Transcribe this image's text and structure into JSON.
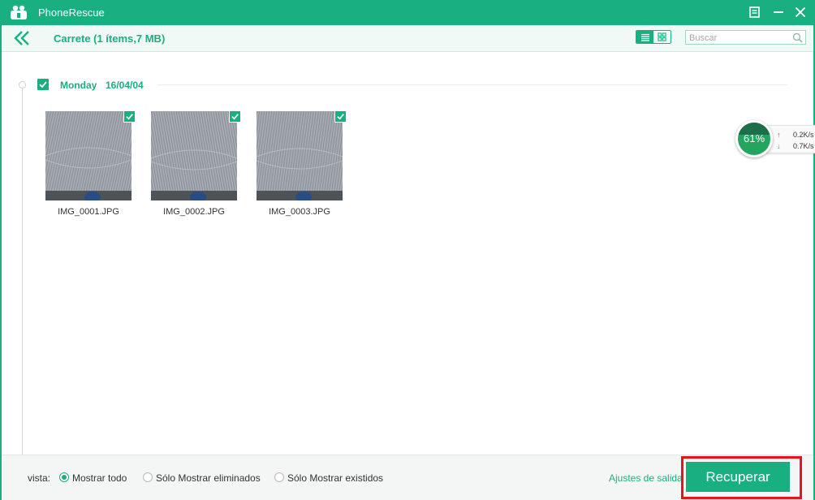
{
  "window": {
    "app_title": "PhoneRescue"
  },
  "toolbar": {
    "title": "Carrete (1 ítems,7 MB)",
    "search_placeholder": "Buscar"
  },
  "group": {
    "day": "Monday",
    "date": "16/04/04"
  },
  "photos": [
    {
      "name": "IMG_0001.JPG",
      "checked": true
    },
    {
      "name": "IMG_0002.JPG",
      "checked": true
    },
    {
      "name": "IMG_0003.JPG",
      "checked": true
    }
  ],
  "speed_widget": {
    "percent_label": "61%",
    "upload": "0.2K/s",
    "download": "0.7K/s"
  },
  "footer": {
    "vista_label": "vista:",
    "options": [
      {
        "label": "Mostrar todo",
        "selected": true
      },
      {
        "label": "Sólo Mostrar eliminados",
        "selected": false
      },
      {
        "label": "Sólo Mostrar existidos",
        "selected": false
      }
    ],
    "output_settings": "Ajustes de salida",
    "recover_label": "Recuperar"
  },
  "colors": {
    "accent": "#1aaf80",
    "highlight": "#e8141b"
  }
}
